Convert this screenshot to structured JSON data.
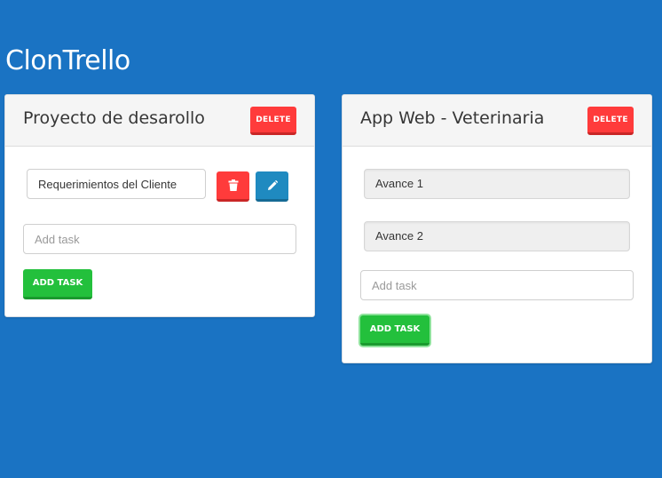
{
  "app": {
    "title": "ClonTrello"
  },
  "boards": [
    {
      "title": "Proyecto de desarollo",
      "delete_label": "DELETE",
      "tasks": [
        {
          "text": "Requerimientos del Cliente",
          "mode": "editing"
        }
      ],
      "add_task_placeholder": "Add task",
      "add_task_label": "ADD TASK"
    },
    {
      "title": "App Web - Veterinaria",
      "delete_label": "DELETE",
      "tasks": [
        {
          "text": "Avance 1",
          "mode": "view"
        },
        {
          "text": "Avance 2",
          "mode": "view"
        }
      ],
      "add_task_placeholder": "Add task",
      "add_task_label": "ADD TASK"
    }
  ],
  "icons": {
    "delete_task": "trash-icon",
    "edit_task": "pencil-icon"
  },
  "colors": {
    "background": "#1a73c3",
    "danger": "#ff3b3b",
    "info": "#1f8ac0",
    "success": "#23c03c"
  }
}
